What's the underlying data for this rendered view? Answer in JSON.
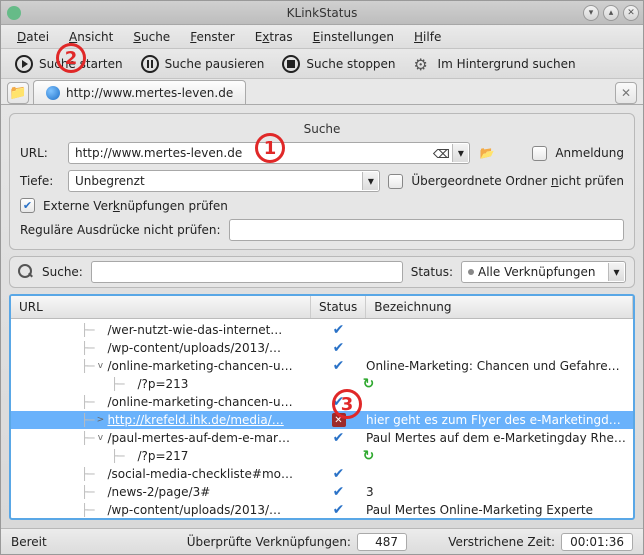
{
  "title": "KLinkStatus",
  "menu": {
    "file": "Datei",
    "view": "Ansicht",
    "search": "Suche",
    "window": "Fenster",
    "extras": "Extras",
    "settings": "Einstellungen",
    "help": "Hilfe"
  },
  "toolbar": {
    "start": "Suche starten",
    "pause": "Suche pausieren",
    "stop": "Suche stoppen",
    "background": "Im Hintergrund suchen"
  },
  "tab": {
    "label": "http://www.mertes-leven.de"
  },
  "group": {
    "title": "Suche",
    "url_label": "URL:",
    "url_value": "http://www.mertes-leven.de",
    "login": "Anmeldung",
    "depth_label": "Tiefe:",
    "depth_value": "Unbegrenzt",
    "parent": "Übergeordnete Ordner nicht prüfen",
    "external": "Externe Verknüpfungen prüfen",
    "regex": "Reguläre Ausdrücke nicht prüfen:"
  },
  "filter": {
    "search": "Suche:",
    "status_label": "Status:",
    "status_value": "Alle Verknüpfungen"
  },
  "columns": {
    "url": "URL",
    "status": "Status",
    "label": "Bezeichnung"
  },
  "rows": [
    {
      "indent": 1,
      "exp": "",
      "url": "/wer-nutzt-wie-das-internet…",
      "st": "ok",
      "label": ""
    },
    {
      "indent": 1,
      "exp": "",
      "url": "/wp-content/uploads/2013/…",
      "st": "ok",
      "label": ""
    },
    {
      "indent": 1,
      "exp": "v",
      "url": "/online-marketing-chancen-u…",
      "st": "ok",
      "label": "Online-Marketing: Chancen und Gefahren für …"
    },
    {
      "indent": 2,
      "exp": "",
      "url": "/?p=213",
      "st": "redir",
      "label": ""
    },
    {
      "indent": 1,
      "exp": "",
      "url": "/online-marketing-chancen-u…",
      "st": "ok",
      "label": ""
    },
    {
      "indent": 1,
      "exp": ">",
      "url": "http://krefeld.ihk.de/media/…",
      "st": "err",
      "label": "hier geht es zum Flyer des e-Marketingdays R…",
      "sel": true
    },
    {
      "indent": 1,
      "exp": "v",
      "url": "/paul-mertes-auf-dem-e-mar…",
      "st": "ok",
      "label": "Paul Mertes auf dem e-Marketingday Rheinlan…"
    },
    {
      "indent": 2,
      "exp": "",
      "url": "/?p=217",
      "st": "redir",
      "label": ""
    },
    {
      "indent": 1,
      "exp": "",
      "url": "/social-media-checkliste#mo…",
      "st": "ok",
      "label": ""
    },
    {
      "indent": 1,
      "exp": "",
      "url": "/news-2/page/3#",
      "st": "ok",
      "label": "3"
    },
    {
      "indent": 1,
      "exp": "",
      "url": "/wp-content/uploads/2013/…",
      "st": "ok",
      "label": "Paul Mertes Online-Marketing Experte"
    }
  ],
  "status": {
    "ready": "Bereit",
    "checked": "Überprüfte Verknüpfungen:",
    "checked_val": "487",
    "elapsed": "Verstrichene Zeit:",
    "elapsed_val": "00:01:36"
  },
  "anno": {
    "1": "1",
    "2": "2",
    "3": "3"
  }
}
